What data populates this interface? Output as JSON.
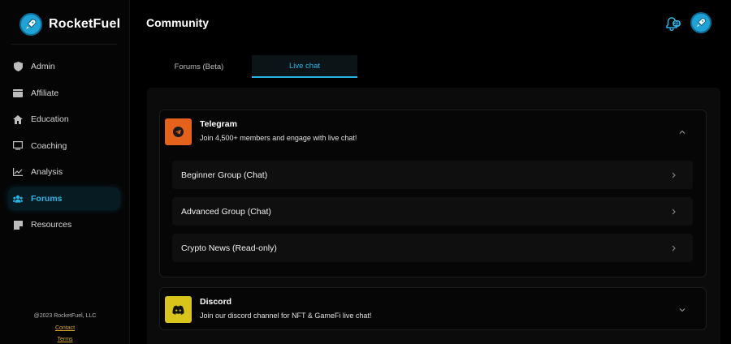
{
  "app": {
    "name": "RocketFuel"
  },
  "sidebar": {
    "items": [
      {
        "label": "Admin",
        "icon": "shield-icon",
        "active": false
      },
      {
        "label": "Affiliate",
        "icon": "wallet-icon",
        "active": false
      },
      {
        "label": "Education",
        "icon": "house-icon",
        "active": false
      },
      {
        "label": "Coaching",
        "icon": "monitor-icon",
        "active": false
      },
      {
        "label": "Analysis",
        "icon": "chart-line-icon",
        "active": false
      },
      {
        "label": "Forums",
        "icon": "users-icon",
        "active": true
      },
      {
        "label": "Resources",
        "icon": "note-icon",
        "active": false
      }
    ],
    "footer": {
      "copyright": "@2023 RocketFuel, LLC",
      "contact": "Contact",
      "terms": "Terms"
    }
  },
  "header": {
    "title": "Community",
    "notification_icon": "bell-icon",
    "avatar_icon": "rocket-avatar-icon"
  },
  "tabs": [
    {
      "label": "Forums (Beta)",
      "active": false
    },
    {
      "label": "Live chat",
      "active": true
    }
  ],
  "channels": {
    "telegram": {
      "title": "Telegram",
      "description": "Join 4,500+ members and engage with live chat!",
      "icon": "telegram-icon",
      "color": "#e4621c",
      "expanded": true,
      "groups": [
        {
          "label": "Beginner Group (Chat)"
        },
        {
          "label": "Advanced Group (Chat)"
        },
        {
          "label": "Crypto News (Read-only)"
        }
      ]
    },
    "discord": {
      "title": "Discord",
      "description": "Join our discord channel for NFT & GameFi live chat!",
      "icon": "discord-icon",
      "color": "#d9c41c",
      "expanded": false
    }
  },
  "colors": {
    "accent": "#29b4e6",
    "background": "#000000",
    "link": "#d6a52a"
  }
}
